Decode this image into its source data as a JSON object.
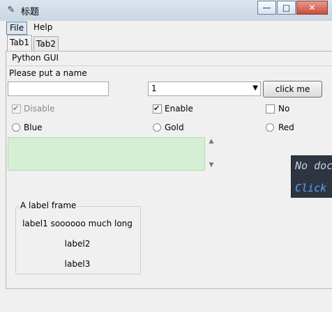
{
  "window": {
    "title": "标题",
    "icon": "feather-icon"
  },
  "menu": {
    "items": [
      "File",
      "Help"
    ]
  },
  "tabs": [
    "Tab1",
    "Tab2"
  ],
  "group": {
    "title": "Python GUI",
    "name_prompt": "Please put a name",
    "name_value": "",
    "combo_value": "1",
    "button_label": "click me"
  },
  "checkboxes": [
    {
      "label": "Disable",
      "checked": true,
      "disabled": true
    },
    {
      "label": "Enable",
      "checked": true,
      "disabled": false
    },
    {
      "label": "No",
      "checked": false,
      "disabled": false
    }
  ],
  "radios": [
    "Blue",
    "Gold",
    "Red"
  ],
  "text_area": {
    "color": "#d5efd5",
    "value": ""
  },
  "tooltip": {
    "line1": "No doc",
    "line2": "Click"
  },
  "label_frame": {
    "title": "A label frame",
    "labels": [
      "label1 soooooo much long",
      "label2",
      "label3"
    ]
  }
}
